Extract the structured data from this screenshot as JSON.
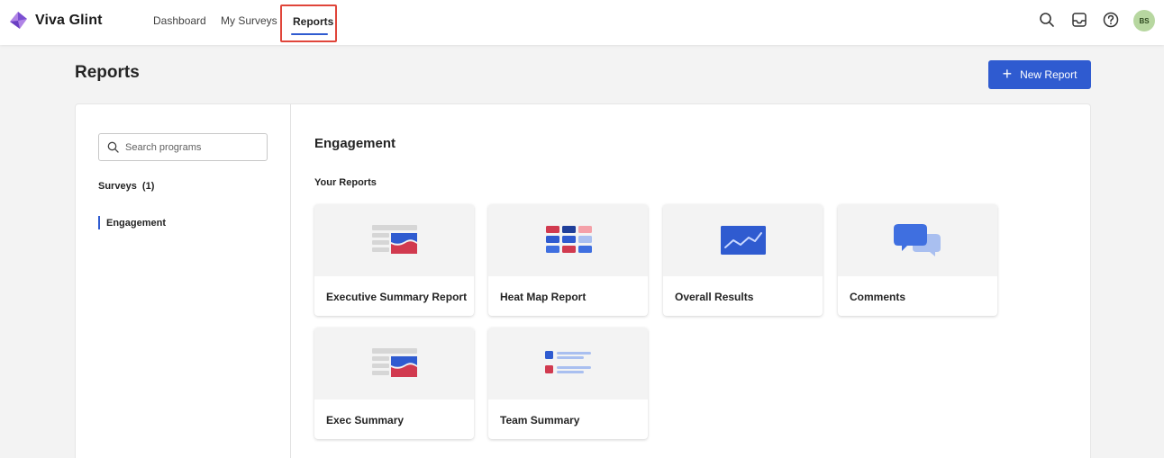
{
  "app": {
    "name": "Viva Glint"
  },
  "nav": {
    "items": [
      {
        "label": "Dashboard"
      },
      {
        "label": "My Surveys"
      },
      {
        "label": "Reports",
        "active": true
      }
    ]
  },
  "topbar": {
    "icons": [
      "search-icon",
      "inbox-icon",
      "help-icon"
    ],
    "avatar_initials": "BS"
  },
  "page": {
    "title": "Reports",
    "new_report_label": "New Report"
  },
  "sidebar": {
    "search_placeholder": "Search programs",
    "surveys_label": "Surveys  (1)",
    "items": [
      {
        "label": "Engagement",
        "selected": true
      }
    ]
  },
  "main": {
    "section_title": "Engagement",
    "your_reports_label": "Your Reports",
    "reports": [
      {
        "label": "Executive Summary Report",
        "icon": "executive-summary-icon"
      },
      {
        "label": "Heat Map Report",
        "icon": "heat-map-icon"
      },
      {
        "label": "Overall Results",
        "icon": "overall-results-icon"
      },
      {
        "label": "Comments",
        "icon": "comments-icon"
      },
      {
        "label": "Exec Summary",
        "icon": "executive-summary-icon"
      },
      {
        "label": "Team Summary",
        "icon": "team-summary-icon"
      }
    ]
  },
  "colors": {
    "accent": "#2f5bd0",
    "highlight_border": "#e0453a",
    "avatar_bg": "#b7d7a0"
  }
}
